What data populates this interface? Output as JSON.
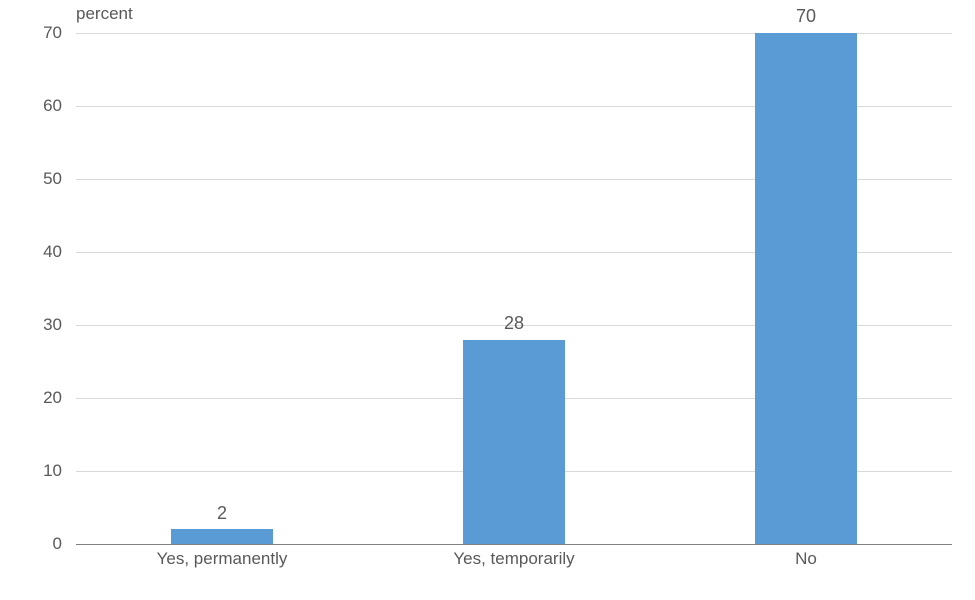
{
  "chart_data": {
    "type": "bar",
    "categories": [
      "Yes, permanently",
      "Yes, temporarily",
      "No"
    ],
    "values": [
      2,
      28,
      70
    ],
    "title": "",
    "xlabel": "",
    "ylabel": "percent",
    "ylim": [
      0,
      70
    ],
    "yticks": [
      0,
      10,
      20,
      30,
      40,
      50,
      60,
      70
    ],
    "bar_color": "#5b9bd5"
  }
}
